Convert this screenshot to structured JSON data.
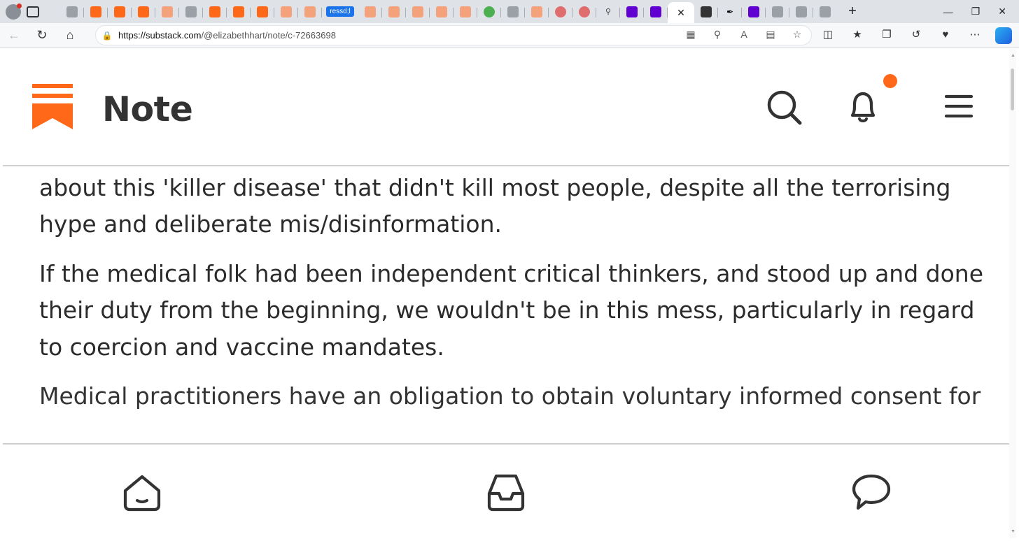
{
  "browser": {
    "tabs": [
      {
        "icon": "profile-icon"
      },
      {
        "icon": "image-icon"
      },
      {
        "icon": "substack-icon"
      },
      {
        "icon": "substack-icon"
      },
      {
        "icon": "substack-icon"
      },
      {
        "icon": "substack-icon"
      },
      {
        "icon": "image-icon"
      },
      {
        "icon": "substack-icon"
      },
      {
        "icon": "substack-icon"
      },
      {
        "icon": "substack-icon"
      },
      {
        "icon": "substack-icon"
      },
      {
        "icon": "substack-icon"
      }
    ],
    "pill_tab_label": "ressd;l",
    "url_host": "https://substack.com",
    "url_path": "/@elizabethhart/note/c-72663698",
    "accent_color": "#1a73e8"
  },
  "app": {
    "title": "Note",
    "brand_color": "#ff6719",
    "has_notification": true
  },
  "note": {
    "paragraphs": [
      "It's bizarre that the highly regarded medical folk were taken in from the beginning about this 'killer disease' that didn't kill most people, despite all the terrorising hype and deliberate mis/disinformation.",
      "If the medical folk had been independent critical thinkers, and stood up and done their duty from the beginning, we wouldn't be in this mess, particularly in regard to coercion and vaccine mandates."
    ],
    "partial_next": "Medical practitioners have an obligation to obtain voluntary informed consent for"
  },
  "bottom_nav": {
    "items": [
      {
        "name": "home",
        "icon": "home-icon"
      },
      {
        "name": "inbox",
        "icon": "inbox-icon"
      },
      {
        "name": "chat",
        "icon": "chat-bubble-icon"
      }
    ]
  }
}
